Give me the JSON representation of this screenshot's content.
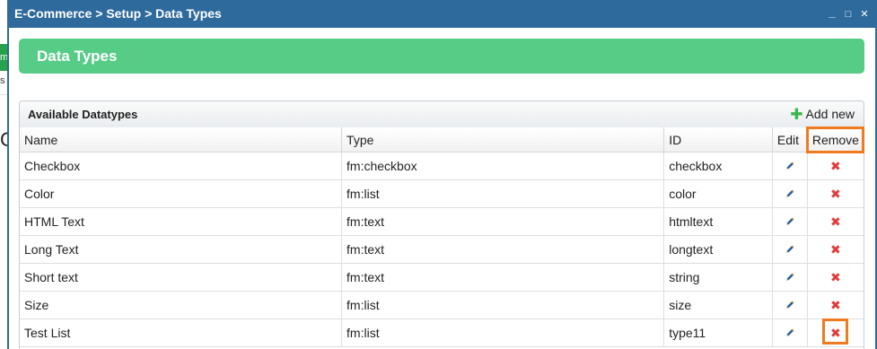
{
  "background": {
    "tab_fragment": "m",
    "glyph_fragment": "s",
    "big_fragment": "C"
  },
  "window": {
    "title": "E-Commerce > Setup > Data Types",
    "controls": {
      "minimize": "_",
      "maximize": "□",
      "close": "✕"
    }
  },
  "header": {
    "title": "Data Types"
  },
  "panel": {
    "title": "Available Datatypes",
    "add_new_label": "Add new",
    "add_icon": "plus-icon"
  },
  "table": {
    "columns": {
      "name": "Name",
      "type": "Type",
      "id": "ID",
      "edit": "Edit",
      "remove": "Remove"
    },
    "rows": [
      {
        "name": "Checkbox",
        "type": "fm:checkbox",
        "id": "checkbox"
      },
      {
        "name": "Color",
        "type": "fm:list",
        "id": "color"
      },
      {
        "name": "HTML Text",
        "type": "fm:text",
        "id": "htmltext"
      },
      {
        "name": "Long Text",
        "type": "fm:text",
        "id": "longtext"
      },
      {
        "name": "Short text",
        "type": "fm:text",
        "id": "string"
      },
      {
        "name": "Size",
        "type": "fm:list",
        "id": "size"
      },
      {
        "name": "Test List",
        "type": "fm:list",
        "id": "type11"
      }
    ],
    "edit_icon": "pencil-icon",
    "remove_icon": "x-icon",
    "remove_glyph": "✖"
  },
  "colors": {
    "titlebar": "#2e6a9c",
    "banner": "#56cc87",
    "highlight": "#f07a1e",
    "remove": "#e03c3c",
    "add": "#3bb54a"
  }
}
